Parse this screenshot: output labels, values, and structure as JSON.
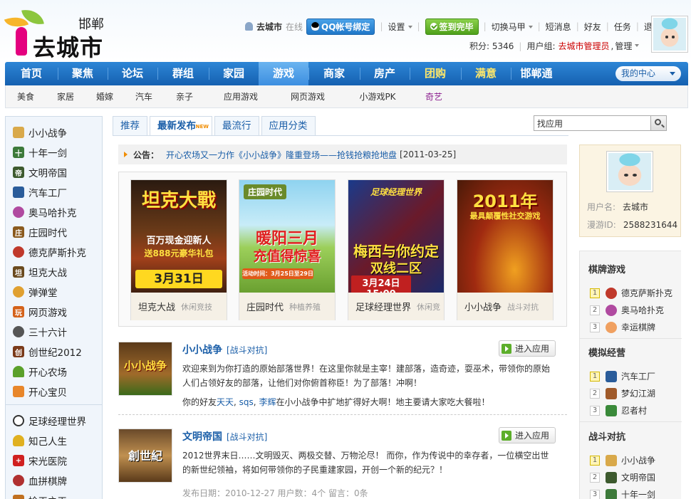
{
  "header": {
    "city": "邯郸",
    "site_name": "去城市",
    "username": "去城市",
    "online_status": "在线",
    "qq_bind": "QQ帐号绑定",
    "settings": "设置",
    "checked_in": "签到完毕",
    "switch_vest": "切换马甲",
    "messages": "短消息",
    "friends": "好友",
    "tasks": "任务",
    "logout": "退出",
    "points": "积分: 5346",
    "user_group_label": "用户组:",
    "user_group": "去城市管理员",
    "manage": "管理"
  },
  "nav": {
    "items": [
      "首页",
      "聚焦",
      "论坛",
      "群组",
      "家园",
      "游戏",
      "商家",
      "房产",
      "团购",
      "满意",
      "邯郸通"
    ],
    "active": "游戏",
    "my_center": "我的中心"
  },
  "subnav": {
    "items": [
      "美食",
      "家居",
      "婚嫁",
      "汽车",
      "亲子",
      "应用游戏",
      "网页游戏",
      "小游戏PK",
      "奇艺"
    ]
  },
  "sidebar": {
    "group1": [
      "小小战争",
      "十年一剑",
      "文明帝国",
      "汽车工厂",
      "奥马哈扑克",
      "庄园时代",
      "德克萨斯扑克",
      "坦克大战",
      "弹弹堂",
      "网页游戏",
      "三十六计",
      "创世纪2012",
      "开心农场",
      "开心宝贝"
    ],
    "group2": [
      "足球经理世界",
      "知己人生",
      "宋光医院",
      "血拼棋牌",
      "捡王之王"
    ]
  },
  "tabs": [
    "推荐",
    "最新发布",
    "最流行",
    "应用分类"
  ],
  "tab_new_badge": "NEW",
  "search": {
    "value": "找应用"
  },
  "notice": {
    "label": "公告：",
    "message": "开心农场又一力作《小小战争》隆重登场——抢钱抢粮抢地盘",
    "date": "[2011-03-25]"
  },
  "featured": [
    {
      "title": "坦克大战",
      "category": "休闲竞技",
      "poster_lines": [
        "坦克大戰",
        "百万现金迎新人",
        "送888元豪华礼包",
        "3月31日10:00"
      ]
    },
    {
      "title": "庄园时代",
      "category": "种植养殖",
      "poster_lines": [
        "庄园时代",
        "暖阳三月",
        "充值得惊喜",
        "活动时间：3月25日至29日"
      ]
    },
    {
      "title": "足球经理世界",
      "category": "休闲竞",
      "poster_lines": [
        "足球经理世界",
        "梅西与你约定",
        "双线二区",
        "3月24日 15:00"
      ]
    },
    {
      "title": "小小战争",
      "category": "战斗对抗",
      "poster_lines": [
        "2011年",
        "最具颠覆性社交游戏"
      ]
    }
  ],
  "apps": [
    {
      "title": "小小战争",
      "category": "[战斗对抗]",
      "enter": "进入应用",
      "description": "欢迎来到为你打造的原始部落世界！在这里你就是主宰！建部落，造奇迹，耍巫术，带领你的原始人们占领好友的部落，让他们对你俯首称臣！为了部落！冲啊！",
      "friends_prefix": "你的好友",
      "friends": [
        "天天",
        "sqs",
        "李辉"
      ],
      "friends_suffix": "在小小战争中扩地扩得好大啊！地主要请大家吃大餐啦！",
      "thumb_text": "小小战争"
    },
    {
      "title": "文明帝国",
      "category": "[战斗对抗]",
      "enter": "进入应用",
      "description": "2012世界末日……文明毁灭、两极交替、万物沦尽！ 而你，作为传说中的幸存者，一位横空出世的新世纪领袖，将如何带领你的子民重建家园，开创一个新的纪元？！",
      "meta": "发布日期：2010-12-27 用户数：4个  留言：0条",
      "thumb_text": "創世紀"
    }
  ],
  "profile": {
    "username_label": "用户名:",
    "username": "去城市",
    "id_label": "漫游ID:",
    "id": "2588231644"
  },
  "rank": {
    "cards_title": "棋牌游戏",
    "cards": [
      "德克萨斯扑克",
      "奥马哈扑克",
      "幸运棋牌"
    ],
    "sim_title": "模拟经营",
    "sim": [
      "汽车工厂",
      "梦幻江湖",
      "忍者村"
    ],
    "battle_title": "战斗对抗",
    "battle": [
      "小小战争",
      "文明帝国",
      "十年一剑"
    ],
    "numbers": [
      "1",
      "2",
      "3"
    ]
  },
  "colors": {
    "nav_blue": "#1a6fc4",
    "link_blue": "#1a5ea8",
    "accent_orange": "#f08c00",
    "admin_red": "#cc0000"
  }
}
